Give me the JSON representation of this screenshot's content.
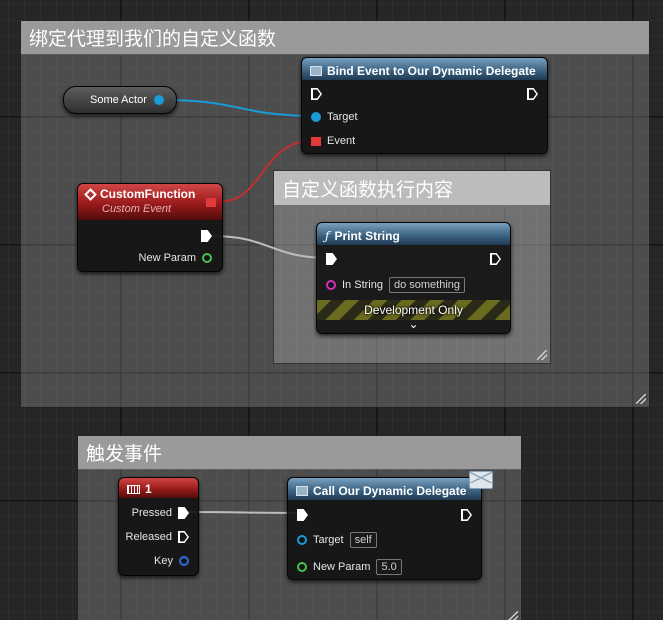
{
  "comments": {
    "bind_section": "绑定代理到我们的自定义函数",
    "function_content": "自定义函数执行内容",
    "trigger_section": "触发事件"
  },
  "nodes": {
    "some_actor": {
      "label": "Some Actor"
    },
    "bind_event": {
      "title": "Bind Event to Our Dynamic Delegate",
      "pin_target": "Target",
      "pin_event": "Event"
    },
    "custom_function": {
      "title": "CustomFunction",
      "subtitle": "Custom Event",
      "pin_new_param": "New Param"
    },
    "print_string": {
      "title": "Print String",
      "fn_glyph": "ƒ",
      "pin_in_string": "In String",
      "in_string_value": "do something",
      "dev_only": "Development Only",
      "expand_glyph": "⌄"
    },
    "key_one": {
      "title": "1",
      "pin_pressed": "Pressed",
      "pin_released": "Released",
      "pin_key": "Key"
    },
    "call_delegate": {
      "title": "Call Our Dynamic Delegate",
      "pin_target": "Target",
      "target_value": "self",
      "pin_new_param": "New Param",
      "new_param_value": "5.0"
    }
  },
  "colors": {
    "object_pin": "#1a9bd7",
    "delegate_pin": "#e03a3a",
    "string_pin": "#d42fb8",
    "float_pin": "#48c24e",
    "struct_pin": "#2a6fd6",
    "exec_wire": "#c8c8c8"
  }
}
